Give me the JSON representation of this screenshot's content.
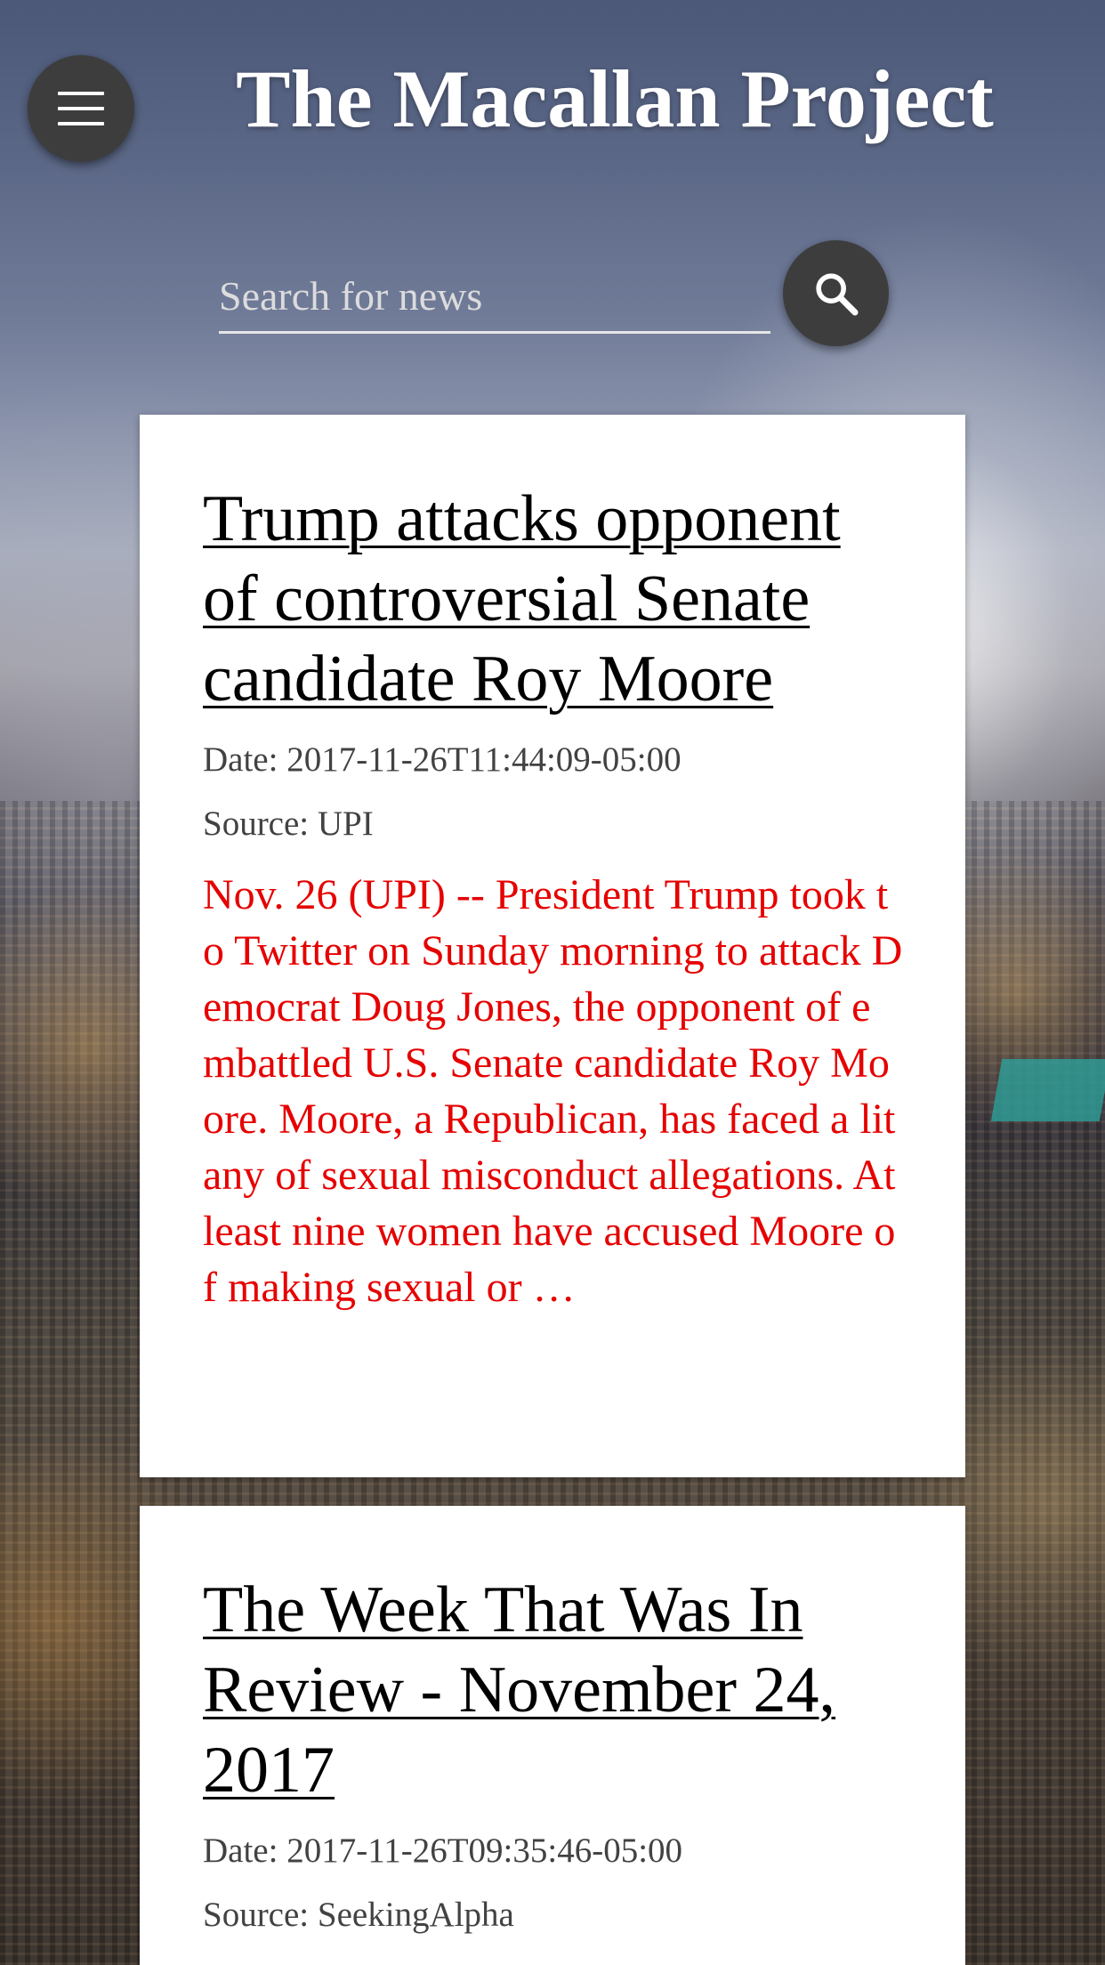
{
  "header": {
    "title": "The Macallan Project",
    "menu_icon": "hamburger-menu-icon"
  },
  "search": {
    "placeholder": "Search for news",
    "value": "",
    "button_icon": "search-icon"
  },
  "articles": [
    {
      "title": "Trump attacks opponent of controversial Senate candidate Roy Moore",
      "date": "Date: 2017-11-26T11:44:09-05:00",
      "source": "Source: UPI",
      "summary": "Nov. 26 (UPI) -- President Trump took to Twitter on Sunday morning to attack Democrat Doug Jones, the opponent of embattled U.S. Senate candidate Roy Moore. Moore, a Republican, has faced a litany of sexual misconduct allegations. At least nine women have accused Moore of making sexual or …"
    },
    {
      "title": "The Week That Was In Review - November 24, 2017",
      "date": "Date: 2017-11-26T09:35:46-05:00",
      "source": "Source: SeekingAlpha",
      "summary": ""
    }
  ],
  "colors": {
    "summary_text": "#e60000",
    "button_bg": "#3d3d3d",
    "card_bg": "#ffffff"
  }
}
